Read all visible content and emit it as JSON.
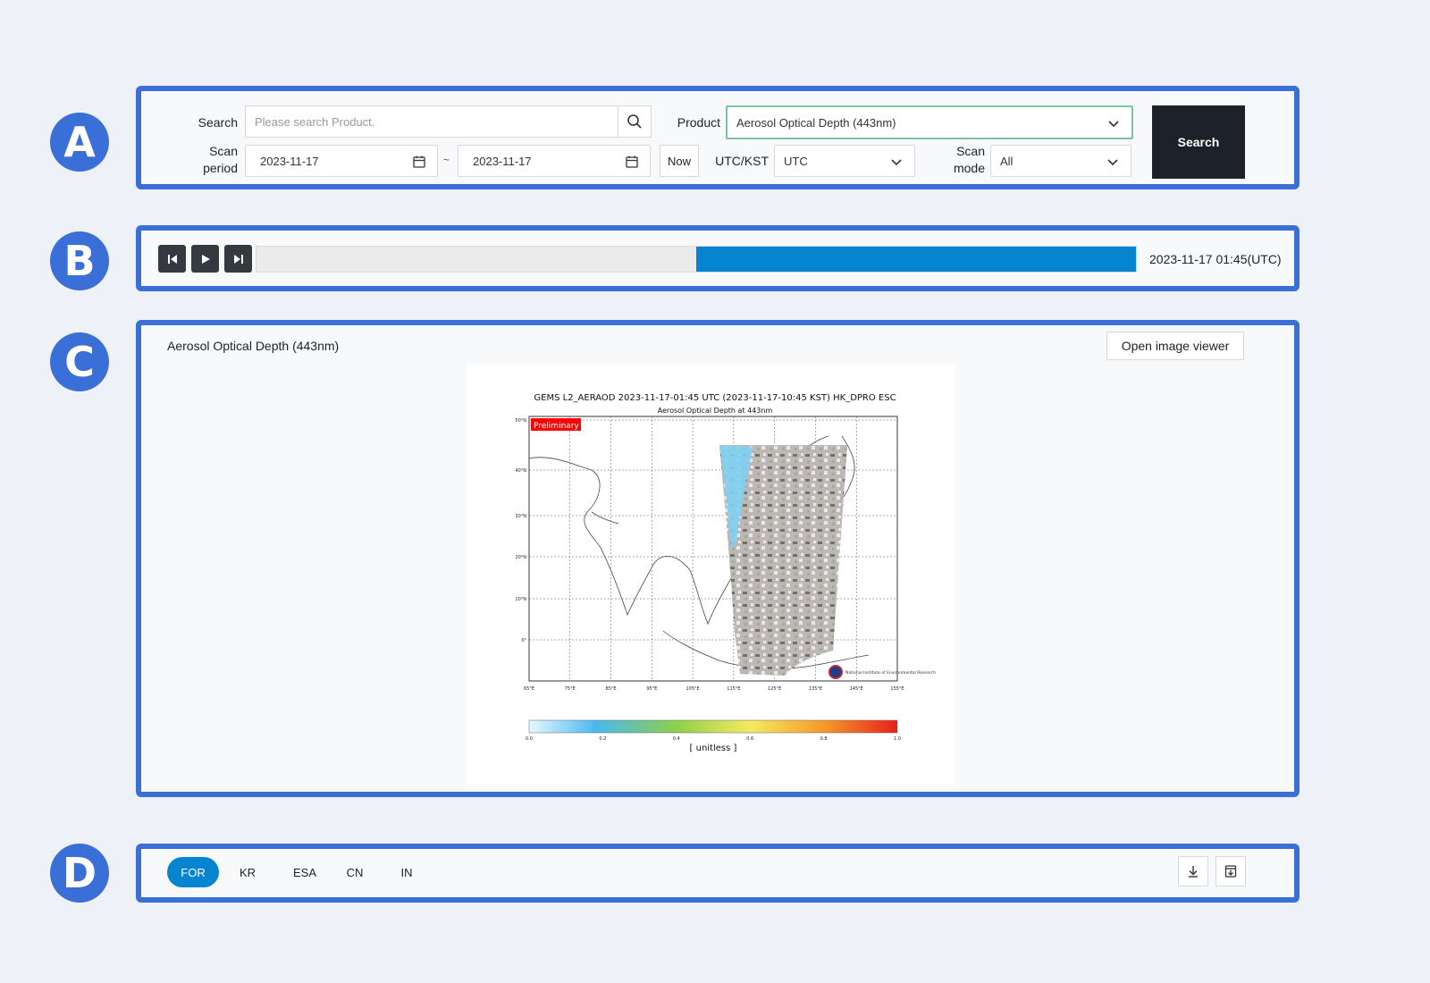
{
  "badges": {
    "a": "A",
    "b": "B",
    "c": "C",
    "d": "D"
  },
  "search": {
    "label": "Search",
    "placeholder": "Please search Product.",
    "product_label": "Product",
    "product_value": "Aerosol Optical Depth (443nm)",
    "period_label": "Scan period",
    "start_date": "2023-11-17",
    "separator": "~",
    "end_date": "2023-11-17",
    "now_label": "Now",
    "tz_label": "UTC/KST",
    "tz_value": "UTC",
    "mode_label": "Scan mode",
    "mode_value": "All",
    "search_button": "Search"
  },
  "player": {
    "progress_percent": 50,
    "time": "2023-11-17 01:45(UTC)"
  },
  "viewer": {
    "title": "Aerosol Optical Depth (443nm)",
    "open_button": "Open image viewer",
    "map_title": "GEMS L2_AERAOD 2023-11-17-01:45 UTC (2023-11-17-10:45 KST)  HK_DPRO ESC",
    "map_subtitle": "Aerosol Optical Depth at 443nm",
    "tag": "Preliminary",
    "colorbar_unit": "[ unitless ]",
    "colorbar_ticks": [
      "0.0",
      "0.2",
      "0.4",
      "0.6",
      "0.8",
      "1.0"
    ],
    "lon_ticks": [
      "65°E",
      "75°E",
      "85°E",
      "95°E",
      "105°E",
      "115°E",
      "125°E",
      "135°E",
      "145°E",
      "155°E"
    ],
    "lat_ticks": [
      "50°N",
      "40°N",
      "30°N",
      "20°N",
      "10°N",
      "0°"
    ],
    "institute": "National Institute of Environmental Research"
  },
  "tabs": [
    "FOR",
    "KR",
    "ESA",
    "CN",
    "IN"
  ],
  "colors": {
    "accent": "#0584d0",
    "frame": "#3b6fd8",
    "dark_button": "#1d2129"
  }
}
